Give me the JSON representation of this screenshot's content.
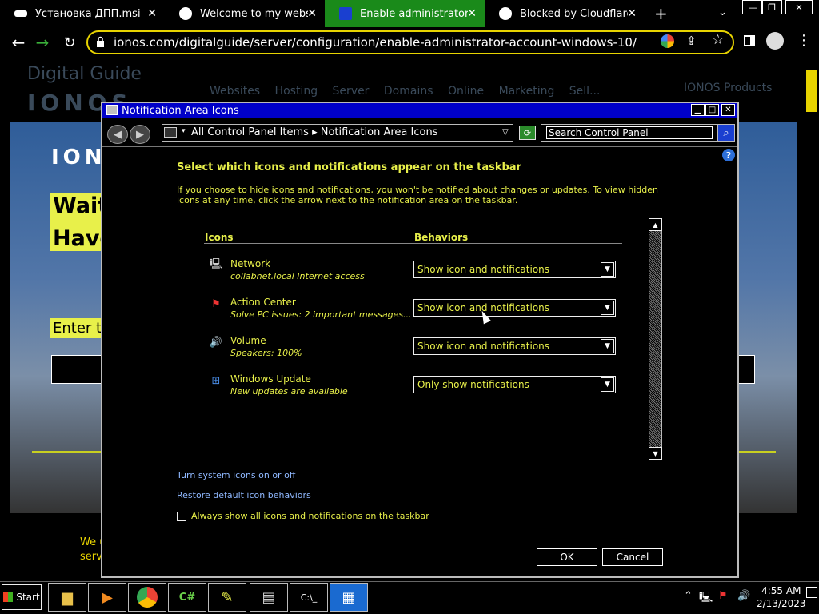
{
  "browser": {
    "tabs": [
      {
        "title": "Установка ДПП.msi — Ян",
        "active": false
      },
      {
        "title": "Welcome to my website!",
        "active": false
      },
      {
        "title": "Enable administrator acc",
        "active": true
      },
      {
        "title": "Blocked by Cloudflare Ga",
        "active": false
      }
    ],
    "url": "ionos.com/digitalguide/server/configuration/enable-administrator-account-windows-10/"
  },
  "webpage": {
    "logo_top": "Digital Guide",
    "logo_bottom": "IONOS",
    "nav_links": "Websites Hosting Server Domains Online Marketing Sell...",
    "products": "IONOS Products",
    "hero_brand": "IONOS",
    "wait_line1": "Wait!",
    "wait_line2": "Have",
    "enter_label": "Enter th",
    "cookie_line1": "We u",
    "cookie_line2": "servi"
  },
  "dialog": {
    "title": "Notification Area Icons",
    "breadcrumb": "All Control Panel Items  ▸  Notification Area Icons",
    "search_placeholder": "Search Control Panel",
    "heading": "Select which icons and notifications appear on the taskbar",
    "description": "If you choose to hide icons and notifications, you won't be notified about changes or updates. To view hidden icons at any time, click the arrow next to the notification area on the taskbar.",
    "col_icons": "Icons",
    "col_behaviors": "Behaviors",
    "rows": [
      {
        "icon": "network-icon",
        "name": "Network",
        "sub": "collabnet.local Internet access",
        "behavior": "Show icon and notifications"
      },
      {
        "icon": "action-center-icon",
        "name": "Action Center",
        "sub": "Solve PC issues: 2 important messages...",
        "behavior": "Show icon and notifications"
      },
      {
        "icon": "volume-icon",
        "name": "Volume",
        "sub": "Speakers: 100%",
        "behavior": "Show icon and notifications"
      },
      {
        "icon": "windows-update-icon",
        "name": "Windows Update",
        "sub": "New updates are available",
        "behavior": "Only show notifications"
      }
    ],
    "link_system_icons": "Turn system icons on or off",
    "link_restore": "Restore default icon behaviors",
    "checkbox_label": "Always show all icons and notifications on the taskbar",
    "ok": "OK",
    "cancel": "Cancel"
  },
  "taskbar": {
    "start": "Start",
    "time": "4:55 AM",
    "date": "2/13/2023"
  },
  "colors": {
    "accent_yellow": "#e8f04a",
    "active_tab": "#1a8a1a",
    "title_bar": "#0000c8"
  }
}
